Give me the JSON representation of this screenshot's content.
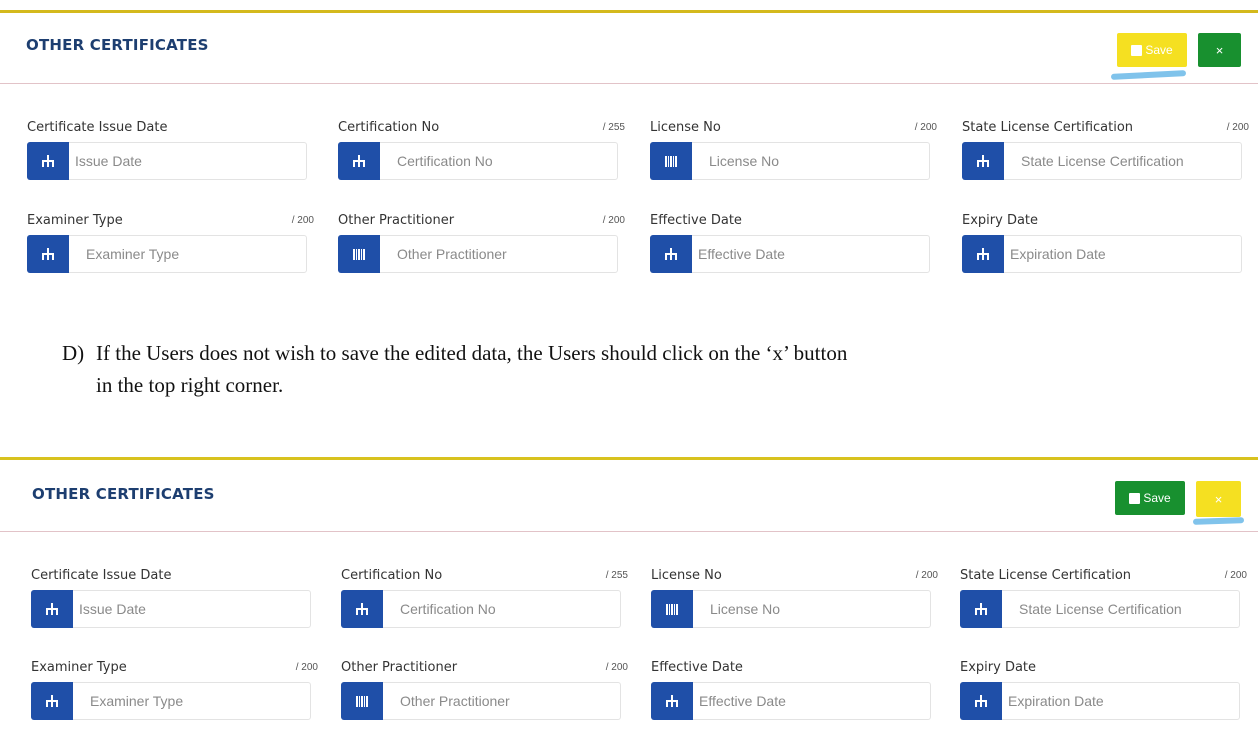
{
  "panel_top": {
    "title": "OTHER CERTIFICATES",
    "save_label": "Save",
    "close_label": "×",
    "save_color": "#f5e021",
    "close_color": "#18902f",
    "fields": [
      {
        "label": "Certificate Issue Date",
        "limit": "",
        "placeholder": "Issue Date",
        "icon": "tree-icon"
      },
      {
        "label": "Certification No",
        "limit": "/ 255",
        "placeholder": "Certification No",
        "icon": "tree-icon"
      },
      {
        "label": "License No",
        "limit": "/ 200",
        "placeholder": "License No",
        "icon": "barcode-icon"
      },
      {
        "label": "State License Certification",
        "limit": "/ 200",
        "placeholder": "State License Certification",
        "icon": "tree-icon"
      },
      {
        "label": "Examiner Type",
        "limit": "/ 200",
        "placeholder": "Examiner Type",
        "icon": "tree-icon"
      },
      {
        "label": "Other Practitioner",
        "limit": "/ 200",
        "placeholder": "Other Practitioner",
        "icon": "barcode-icon"
      },
      {
        "label": "Effective Date",
        "limit": "",
        "placeholder": "Effective Date",
        "icon": "tree-icon"
      },
      {
        "label": "Expiry Date",
        "limit": "",
        "placeholder": "Expiration Date",
        "icon": "tree-icon"
      }
    ]
  },
  "instruction": {
    "marker": "D)",
    "line1": "If the Users does not wish to save the edited data, the Users should click on the ‘x’ button",
    "line2": "in the top right corner."
  },
  "panel_bottom": {
    "title": "OTHER CERTIFICATES",
    "save_label": "Save",
    "close_label": "×",
    "save_color": "#18902f",
    "close_color": "#f5e021",
    "fields": [
      {
        "label": "Certificate Issue Date",
        "limit": "",
        "placeholder": "Issue Date",
        "icon": "tree-icon"
      },
      {
        "label": "Certification No",
        "limit": "/ 255",
        "placeholder": "Certification No",
        "icon": "tree-icon"
      },
      {
        "label": "License No",
        "limit": "/ 200",
        "placeholder": "License No",
        "icon": "barcode-icon"
      },
      {
        "label": "State License Certification",
        "limit": "/ 200",
        "placeholder": "State License Certification",
        "icon": "tree-icon"
      },
      {
        "label": "Examiner Type",
        "limit": "/ 200",
        "placeholder": "Examiner Type",
        "icon": "tree-icon"
      },
      {
        "label": "Other Practitioner",
        "limit": "/ 200",
        "placeholder": "Other Practitioner",
        "icon": "barcode-icon"
      },
      {
        "label": "Effective Date",
        "limit": "",
        "placeholder": "Effective Date",
        "icon": "tree-icon"
      },
      {
        "label": "Expiry Date",
        "limit": "",
        "placeholder": "Expiration Date",
        "icon": "tree-icon"
      }
    ]
  }
}
